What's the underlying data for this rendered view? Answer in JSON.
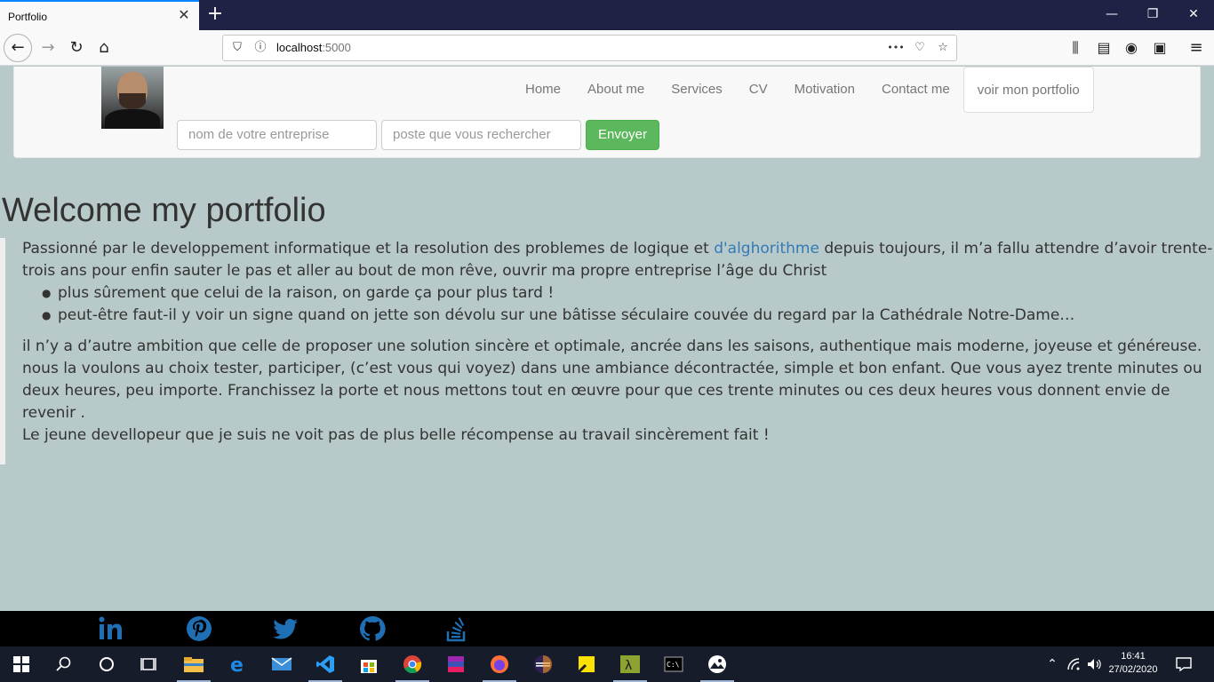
{
  "browser": {
    "tab_title": "Portfolio",
    "url_host": "localhost",
    "url_port": ":5000",
    "url_more": "•••"
  },
  "site": {
    "menu": [
      "Home",
      "About me",
      "Services",
      "CV",
      "Motivation",
      "Contact me"
    ],
    "portfolio_button": "voir mon portfolio",
    "company_placeholder": "nom de votre entreprise",
    "job_placeholder": "poste que vous rechercher",
    "send_button": "Envoyer"
  },
  "content": {
    "title": "Welcome my portfolio",
    "intro_before": "Passionné par le developpement informatique et la resolution des problemes de logique et ",
    "intro_link": "d'alghorithme",
    "intro_after": " depuis toujours, il m’a fallu attendre d’avoir trente-trois ans pour enfin sauter le pas et aller au bout de mon rêve, ouvrir ma propre entreprise l’âge du Christ",
    "bullets": [
      "plus sûrement que celui de la raison, on garde ça pour plus tard !",
      "peut-être faut-il y voir un signe quand on jette son dévolu sur une bâtisse séculaire couvée du regard par la Cathédrale Notre-Dame…"
    ],
    "paragraph2": "il n’y a d’autre ambition que celle de proposer une solution sincère et optimale, ancrée dans les saisons, authentique mais moderne, joyeuse et généreuse. nous la voulons au choix tester, participer, (c’est vous qui voyez) dans une ambiance décontractée, simple et bon enfant. Que vous ayez trente minutes ou deux heures, peu importe. Franchissez la porte et nous mettons tout en œuvre pour que ces trente minutes ou ces deux heures vous donnent envie de revenir .",
    "paragraph3": "Le jeune devellopeur que je suis ne voit pas de plus belle récompense au travail sincèrement fait !"
  },
  "footer": {
    "icons": [
      "linkedin-icon",
      "pinterest-icon",
      "twitter-icon",
      "github-icon",
      "stackoverflow-icon"
    ],
    "icon_color": "#1f6fb5"
  },
  "taskbar": {
    "time": "16:41",
    "date": "27/02/2020"
  }
}
